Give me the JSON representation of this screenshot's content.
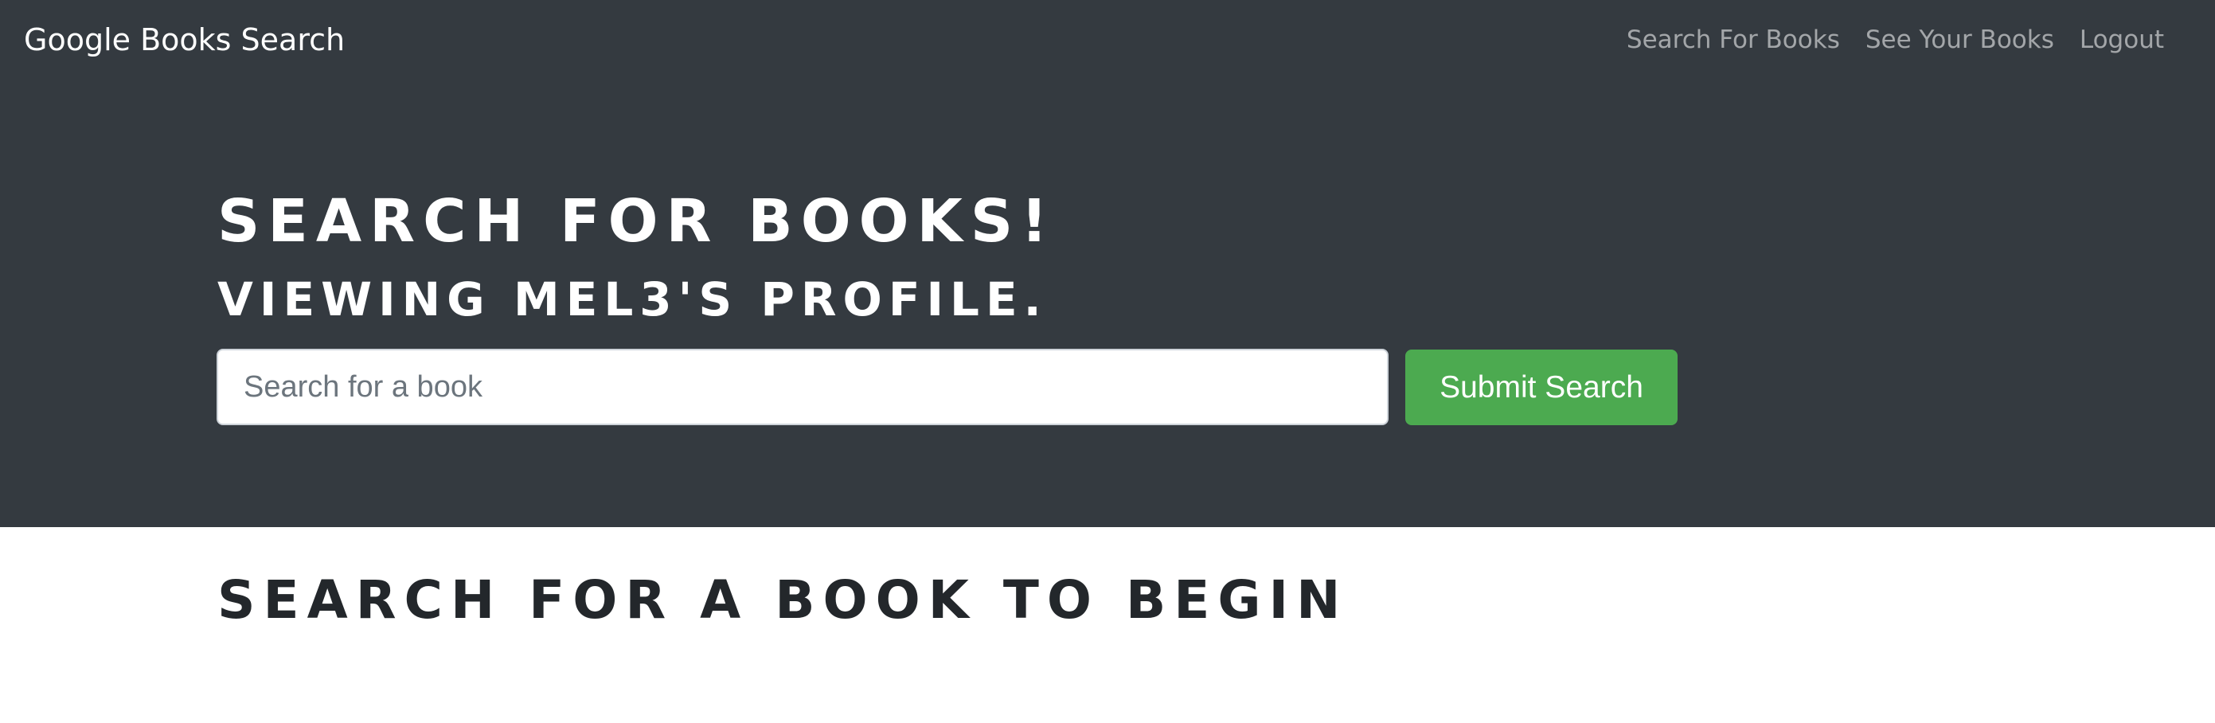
{
  "navbar": {
    "brand": "Google Books Search",
    "links": [
      {
        "label": "Search For Books"
      },
      {
        "label": "See Your Books"
      },
      {
        "label": "Logout"
      }
    ]
  },
  "hero": {
    "title": "SEARCH FOR BOOKS!",
    "subtitle": "VIEWING MEL3'S PROFILE.",
    "search_placeholder": "Search for a book",
    "search_value": "",
    "submit_label": "Submit Search"
  },
  "results": {
    "heading": "SEARCH FOR A BOOK TO BEGIN"
  },
  "colors": {
    "navbar_bg": "#343a40",
    "submit_button": "#4caa50",
    "heading_text": "#23272b"
  }
}
